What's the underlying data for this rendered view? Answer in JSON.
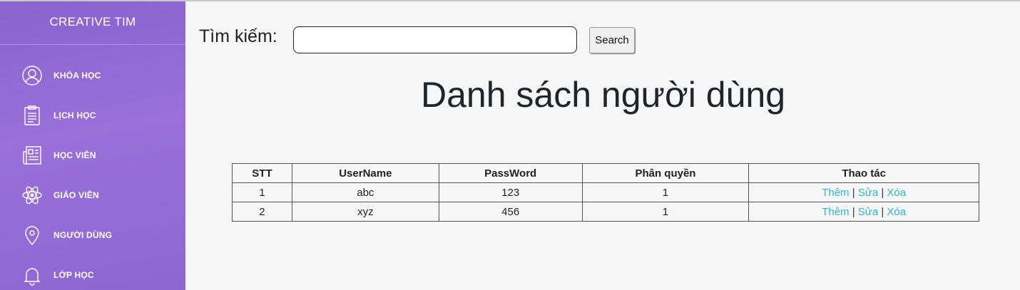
{
  "sidebar": {
    "brand": "CREATIVE TIM",
    "items": [
      {
        "label": "KHÓA HỌC",
        "icon": "user-circle-icon"
      },
      {
        "label": "LỊCH HỌC",
        "icon": "clipboard-icon"
      },
      {
        "label": "HỌC VIÊN",
        "icon": "newspaper-icon"
      },
      {
        "label": "GIÁO VIÊN",
        "icon": "atom-icon"
      },
      {
        "label": "NGƯỜI DÙNG",
        "icon": "map-pin-icon"
      },
      {
        "label": "LỚP HỌC",
        "icon": "bell-icon"
      }
    ]
  },
  "search": {
    "label": "Tìm kiếm:",
    "value": "",
    "button": "Search"
  },
  "page_title": "Danh sách người dùng",
  "table": {
    "headers": [
      "STT",
      "UserName",
      "PassWord",
      "Phân quyền",
      "Thao tác"
    ],
    "rows": [
      {
        "stt": "1",
        "username": "abc",
        "password": "123",
        "role": "1"
      },
      {
        "stt": "2",
        "username": "xyz",
        "password": "456",
        "role": "1"
      }
    ],
    "actions": {
      "add": "Thêm",
      "edit": "Sửa",
      "delete": "Xóa",
      "separator": "|"
    }
  },
  "colors": {
    "sidebar_bg": "#9169d4",
    "link": "#2fb2d6",
    "page_bg": "#f6f6f6"
  }
}
